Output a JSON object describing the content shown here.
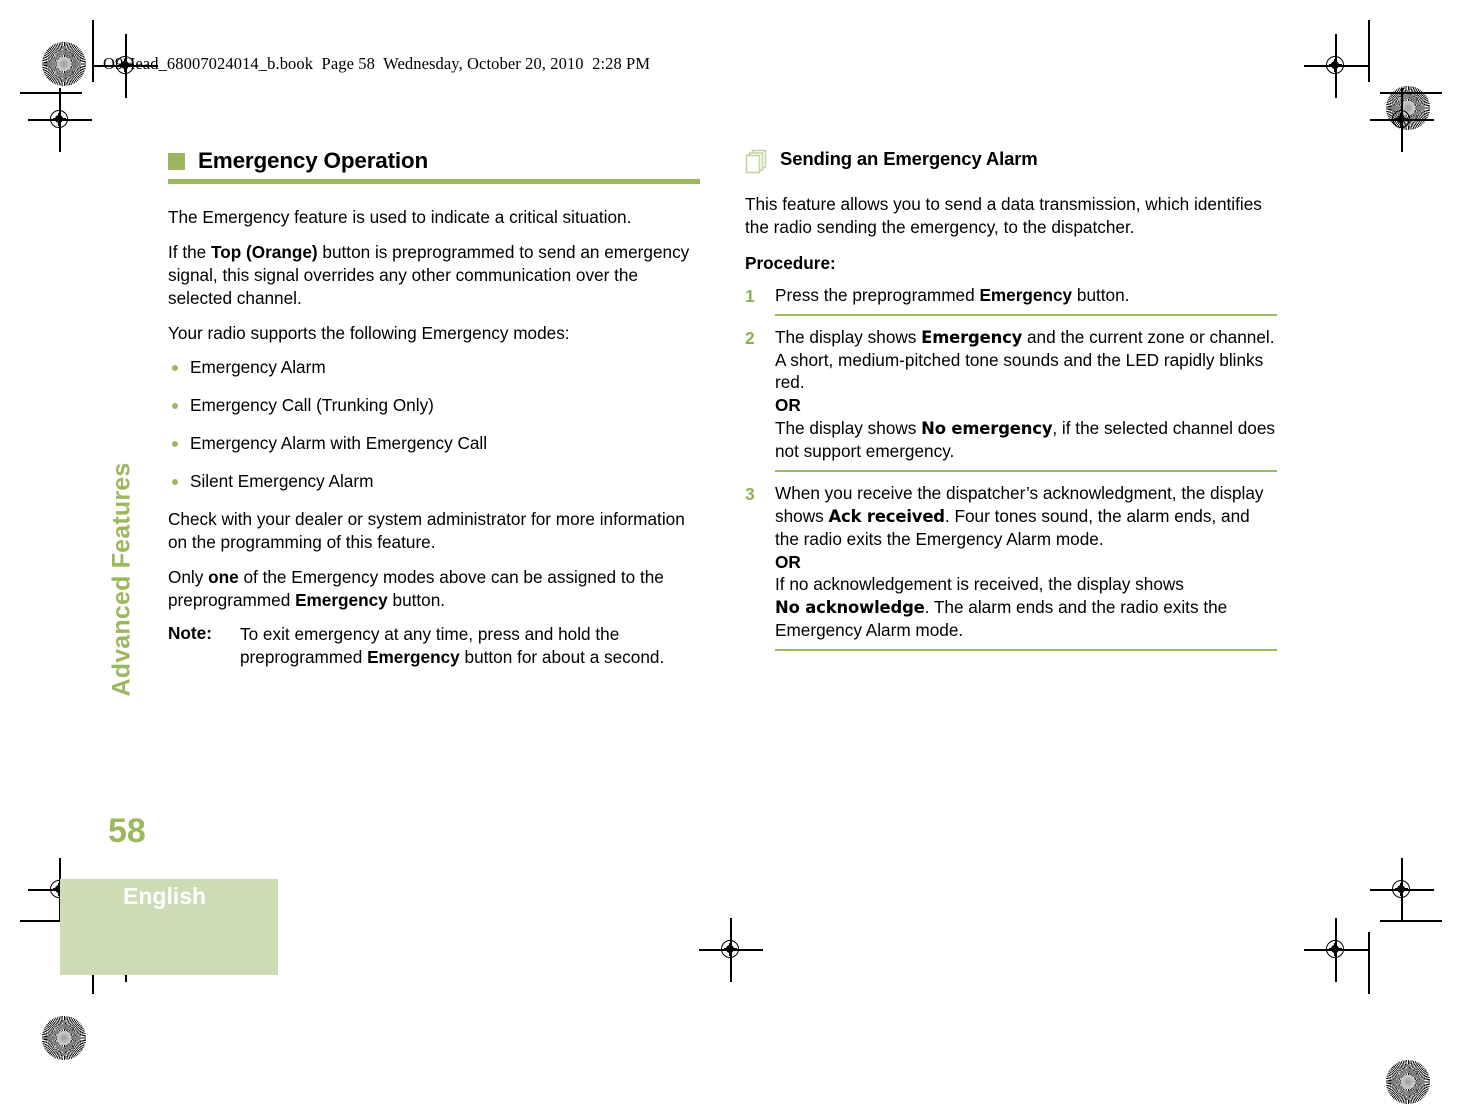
{
  "header": {
    "slug": "O9Head_68007024014_b.book  Page 58  Wednesday, October 20, 2010  2:28 PM"
  },
  "sidebar": {
    "chapter": "Advanced Features",
    "page_number": "58",
    "language": "English",
    "accent_color": "#9BB85F",
    "language_block_color": "#CDDCB4"
  },
  "left_column": {
    "heading": "Emergency Operation",
    "heading_icon": "green-square-bullet-icon",
    "paragraphs": {
      "p1": "The Emergency feature is used to indicate a critical situation.",
      "p2_a": "If the ",
      "p2_bold": "Top (Orange)",
      "p2_b": " button is preprogrammed to send an emergency signal, this signal overrides any other communication over the selected channel.",
      "p3": "Your radio supports the following Emergency modes:",
      "p4": "Check with your dealer or system administrator for more information on the programming of this feature.",
      "p5_a": "Only ",
      "p5_bold1": "one",
      "p5_b": " of the Emergency modes above can be assigned to the preprogrammed ",
      "p5_bold2": "Emergency",
      "p5_c": " button."
    },
    "modes": [
      "Emergency Alarm",
      "Emergency Call (Trunking Only)",
      "Emergency Alarm with Emergency Call",
      "Silent Emergency Alarm"
    ],
    "note": {
      "label": "Note:",
      "text_a": "To exit emergency at any time, press and hold the preprogrammed ",
      "text_bold": "Emergency",
      "text_b": " button for about a second."
    }
  },
  "right_column": {
    "heading": "Sending an Emergency Alarm",
    "heading_icon": "document-stack-icon",
    "intro": "This feature allows you to send a data transmission, which identifies the radio sending the emergency, to the dispatcher.",
    "procedure_label": "Procedure:",
    "steps": [
      {
        "number": "1",
        "text_a": "Press the preprogrammed ",
        "bold1": "Emergency",
        "text_b": " button."
      },
      {
        "number": "2",
        "text_a": "The display shows ",
        "display1": "Emergency",
        "text_b": " and the current zone or channel. A short, medium-pitched tone sounds and the LED rapidly blinks red.",
        "or_label": "OR",
        "text_c": "The display shows ",
        "display2": "No emergency",
        "text_d": ", if the selected channel does not support emergency."
      },
      {
        "number": "3",
        "text_a": "When you receive the dispatcher’s acknowledgment, the display shows ",
        "display1": "Ack received",
        "text_b": ". Four tones sound, the alarm ends, and the radio exits the Emergency Alarm mode.",
        "or_label": "OR",
        "text_c": "If no acknowledgement is received, the display shows ",
        "display2": "No acknowledge",
        "text_d": ". The alarm ends and the radio exits the Emergency Alarm mode."
      }
    ]
  }
}
